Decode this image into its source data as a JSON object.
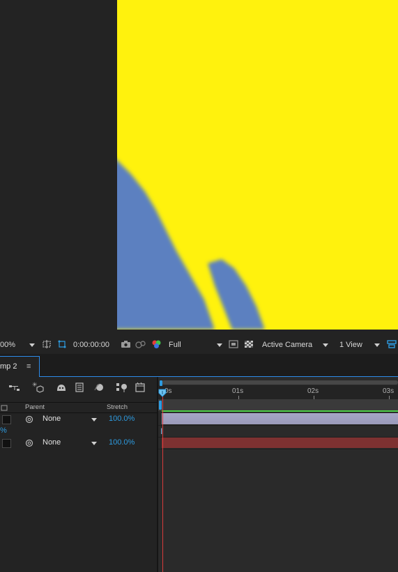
{
  "viewer": {
    "colors": {
      "background": "#fff20d",
      "shape": "#5b80c0"
    }
  },
  "viewer_toolbar": {
    "zoom": "00%",
    "timecode": "0:00:00:00",
    "resolution": "Full",
    "camera": "Active Camera",
    "views": "1 View",
    "icons": [
      "region-of-interest-icon",
      "transparency-grid-icon",
      "snapshot-icon",
      "show-snapshot-icon",
      "color-channel-icon",
      "fast-preview-icon",
      "toggle-alpha-icon",
      "view-layout-icon"
    ]
  },
  "timeline": {
    "tab_label": "mp 2",
    "tab_menu": "≡",
    "columns": {
      "parent": "Parent",
      "stretch": "Stretch"
    },
    "layers": [
      {
        "parent": "None",
        "stretch": "100.0%",
        "bar_color": "#9a9aba"
      },
      {
        "parent": "None",
        "stretch": "100.0%",
        "bar_color": "#7d3131"
      }
    ],
    "sub_value": "%",
    "ruler": [
      "0s",
      "01s",
      "02s",
      "03s"
    ],
    "colors": {
      "accent": "#2d8ceb",
      "playhead": "#d83a3a",
      "stretch": "#2d9be0"
    }
  }
}
